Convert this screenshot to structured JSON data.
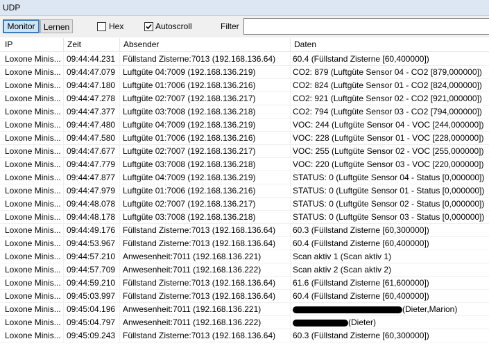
{
  "window": {
    "title": "UDP"
  },
  "toolbar": {
    "monitor_label": "Monitor",
    "lernen_label": "Lernen",
    "hex_label": "Hex",
    "hex_checked": false,
    "autoscroll_label": "Autoscroll",
    "autoscroll_checked": true,
    "filter_label": "Filter",
    "filter_value": ""
  },
  "table": {
    "columns": [
      "IP",
      "Zeit",
      "Absender",
      "Daten"
    ],
    "rows": [
      {
        "ip": "Loxone Minis...",
        "zeit": "09:44:44.231",
        "absender": "Füllstand Zisterne:7013 (192.168.136.64)",
        "daten": "60.4 (Füllstand Zisterne [60,400000])"
      },
      {
        "ip": "Loxone Minis...",
        "zeit": "09:44:47.079",
        "absender": "Luftgüte 04:7009 (192.168.136.219)",
        "daten": "CO2: 879 (Luftgüte Sensor 04 - CO2 [879,000000])"
      },
      {
        "ip": "Loxone Minis...",
        "zeit": "09:44:47.180",
        "absender": "Luftgüte 01:7006 (192.168.136.216)",
        "daten": "CO2: 824 (Luftgüte Sensor 01 - CO2 [824,000000])"
      },
      {
        "ip": "Loxone Minis...",
        "zeit": "09:44:47.278",
        "absender": "Luftgüte 02:7007 (192.168.136.217)",
        "daten": "CO2: 921 (Luftgüte Sensor 02 - CO2 [921,000000])"
      },
      {
        "ip": "Loxone Minis...",
        "zeit": "09:44:47.377",
        "absender": "Luftgüte 03:7008 (192.168.136.218)",
        "daten": "CO2: 794 (Luftgüte Sensor 03 - CO2 [794,000000])"
      },
      {
        "ip": "Loxone Minis...",
        "zeit": "09:44:47.480",
        "absender": "Luftgüte 04:7009 (192.168.136.219)",
        "daten": "VOC: 244 (Luftgüte Sensor 04 - VOC [244,000000])"
      },
      {
        "ip": "Loxone Minis...",
        "zeit": "09:44:47.580",
        "absender": "Luftgüte 01:7006 (192.168.136.216)",
        "daten": "VOC: 228 (Luftgüte Sensor 01 - VOC [228,000000])"
      },
      {
        "ip": "Loxone Minis...",
        "zeit": "09:44:47.677",
        "absender": "Luftgüte 02:7007 (192.168.136.217)",
        "daten": "VOC: 255 (Luftgüte Sensor 02 - VOC [255,000000])"
      },
      {
        "ip": "Loxone Minis...",
        "zeit": "09:44:47.779",
        "absender": "Luftgüte 03:7008 (192.168.136.218)",
        "daten": "VOC: 220 (Luftgüte Sensor 03 - VOC [220,000000])"
      },
      {
        "ip": "Loxone Minis...",
        "zeit": "09:44:47.877",
        "absender": "Luftgüte 04:7009 (192.168.136.219)",
        "daten": "STATUS: 0 (Luftgüte Sensor 04 - Status [0,000000])"
      },
      {
        "ip": "Loxone Minis...",
        "zeit": "09:44:47.979",
        "absender": "Luftgüte 01:7006 (192.168.136.216)",
        "daten": "STATUS: 0 (Luftgüte Sensor 01 - Status [0,000000])"
      },
      {
        "ip": "Loxone Minis...",
        "zeit": "09:44:48.078",
        "absender": "Luftgüte 02:7007 (192.168.136.217)",
        "daten": "STATUS: 0 (Luftgüte Sensor 02 - Status [0,000000])"
      },
      {
        "ip": "Loxone Minis...",
        "zeit": "09:44:48.178",
        "absender": "Luftgüte 03:7008 (192.168.136.218)",
        "daten": "STATUS: 0 (Luftgüte Sensor 03 - Status [0,000000])"
      },
      {
        "ip": "Loxone Minis...",
        "zeit": "09:44:49.176",
        "absender": "Füllstand Zisterne:7013 (192.168.136.64)",
        "daten": "60.3 (Füllstand Zisterne [60,300000])"
      },
      {
        "ip": "Loxone Minis...",
        "zeit": "09:44:53.967",
        "absender": "Füllstand Zisterne:7013 (192.168.136.64)",
        "daten": "60.4 (Füllstand Zisterne [60,400000])"
      },
      {
        "ip": "Loxone Minis...",
        "zeit": "09:44:57.210",
        "absender": "Anwesenheit:7011 (192.168.136.221)",
        "daten": "Scan aktiv 1 (Scan aktiv 1)"
      },
      {
        "ip": "Loxone Minis...",
        "zeit": "09:44:57.709",
        "absender": "Anwesenheit:7011 (192.168.136.222)",
        "daten": "Scan aktiv 2 (Scan aktiv 2)"
      },
      {
        "ip": "Loxone Minis...",
        "zeit": "09:44:59.210",
        "absender": "Füllstand Zisterne:7013 (192.168.136.64)",
        "daten": "61.6 (Füllstand Zisterne [61,600000])"
      },
      {
        "ip": "Loxone Minis...",
        "zeit": "09:45:03.997",
        "absender": "Füllstand Zisterne:7013 (192.168.136.64)",
        "daten": "60.4 (Füllstand Zisterne [60,400000])"
      },
      {
        "ip": "Loxone Minis...",
        "zeit": "09:45:04.196",
        "absender": "Anwesenheit:7011 (192.168.136.221)",
        "daten": "(Dieter,Marion)",
        "redacted": true
      },
      {
        "ip": "Loxone Minis...",
        "zeit": "09:45:04.797",
        "absender": "Anwesenheit:7011 (192.168.136.222)",
        "daten": "(Dieter)",
        "redacted": true
      },
      {
        "ip": "Loxone Minis...",
        "zeit": "09:45:09.243",
        "absender": "Füllstand Zisterne:7013 (192.168.136.64)",
        "daten": "60.3 (Füllstand Zisterne [60,300000])"
      }
    ]
  }
}
